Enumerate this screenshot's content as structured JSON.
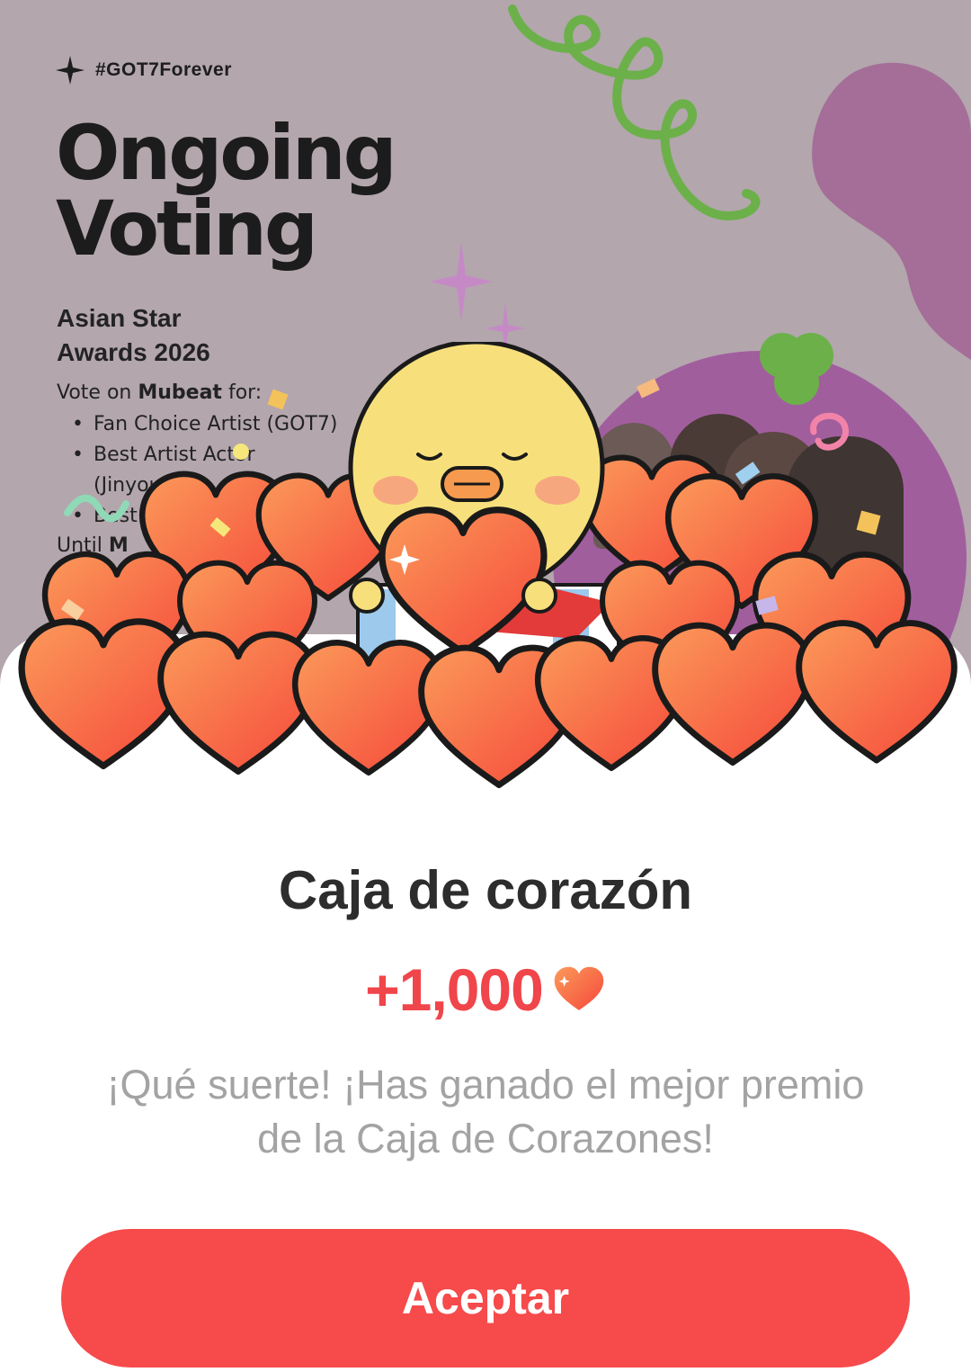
{
  "banner": {
    "hashtag": "#GOT7Forever",
    "title_line1": "Ongoing",
    "title_line2": "Voting",
    "award_line1": "Asian Star",
    "award_line2": "Awards 2026",
    "vote_prefix": "Vote on ",
    "vote_app": "Mubeat",
    "vote_suffix": " for:",
    "bullets": [
      "Fan Choice Artist (GOT7)",
      "Best Artist Actor",
      "(Jinyoung)",
      "Best Sol"
    ],
    "until_prefix": "Until ",
    "until_value": "M"
  },
  "reward": {
    "title": "Caja de corazón",
    "amount": "+1,000",
    "currency_icon": "heart-icon",
    "message_line1": "¡Qué suerte! ¡Has ganado el mejor premio",
    "message_line2": "de la Caja de Corazones!"
  },
  "actions": {
    "accept_label": "Aceptar"
  },
  "colors": {
    "banner_bg": "#b3a6ad",
    "accent_red": "#f64a4b",
    "amount_red": "#f0454a",
    "heart_light": "#fb9a5a",
    "heart_dark": "#f5483a",
    "text_dark": "#2d2d2d",
    "text_muted": "#a3a3a3"
  }
}
